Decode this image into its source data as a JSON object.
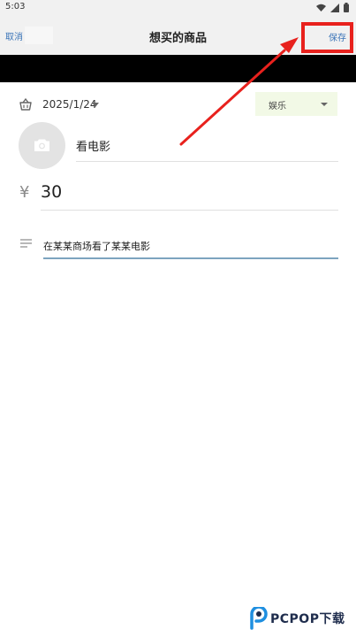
{
  "status_bar": {
    "time": "5:03"
  },
  "app_bar": {
    "cancel_label": "取消",
    "title": "想买的商品",
    "save_label": "保存"
  },
  "form": {
    "date": "2025/1/24",
    "category": "娱乐",
    "name": "看电影",
    "currency_symbol": "¥",
    "price": "30",
    "note": "在某某商场看了某某电影"
  },
  "icons": {
    "status": [
      "wifi-icon",
      "signal-icon",
      "battery-icon"
    ],
    "date": "basket-icon",
    "photo": "camera-icon",
    "notes": "notes-lines-icon"
  },
  "colors": {
    "accent_link": "#3a74b8",
    "highlight_red": "#e8211d",
    "category_bg": "#f2f9e6",
    "note_underline": "#7da4bf"
  },
  "watermark": {
    "brand": "PCPOP下载"
  }
}
